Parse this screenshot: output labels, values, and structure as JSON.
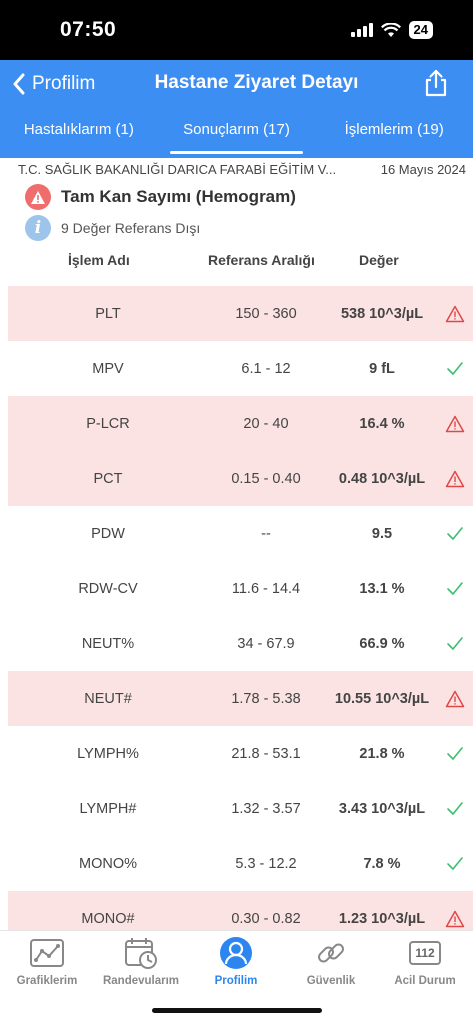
{
  "status": {
    "time": "07:50",
    "battery": "24"
  },
  "nav": {
    "back_label": "Profilim",
    "title": "Hastane Ziyaret Detayı"
  },
  "tabs": [
    {
      "label": "Hastalıklarım (1)"
    },
    {
      "label": "Sonuçlarım (17)"
    },
    {
      "label": "İşlemlerim (19)"
    }
  ],
  "visit": {
    "hospital": "T.C. SAĞLIK BAKANLIĞI DARICA FARABİ EĞİTİM V...",
    "date": "16 Mayıs 2024",
    "test_name": "Tam Kan Sayımı (Hemogram)",
    "out_of_range_text": "9 Değer Referans Dışı"
  },
  "columns": {
    "name": "İşlem Adı",
    "range": "Referans Aralığı",
    "value": "Değer"
  },
  "results": [
    {
      "name": "PLT",
      "range": "150 - 360",
      "value": "538 10^3/µL",
      "out": true
    },
    {
      "name": "MPV",
      "range": "6.1 - 12",
      "value": "9 fL",
      "out": false
    },
    {
      "name": "P-LCR",
      "range": "20 - 40",
      "value": "16.4 %",
      "out": true
    },
    {
      "name": "PCT",
      "range": "0.15 - 0.40",
      "value": "0.48 10^3/µL",
      "out": true
    },
    {
      "name": "PDW",
      "range": "--",
      "value": "9.5",
      "out": false
    },
    {
      "name": "RDW-CV",
      "range": "11.6 - 14.4",
      "value": "13.1 %",
      "out": false
    },
    {
      "name": "NEUT%",
      "range": "34 - 67.9",
      "value": "66.9 %",
      "out": false
    },
    {
      "name": "NEUT#",
      "range": "1.78 - 5.38",
      "value": "10.55 10^3/µL",
      "out": true
    },
    {
      "name": "LYMPH%",
      "range": "21.8 - 53.1",
      "value": "21.8 %",
      "out": false
    },
    {
      "name": "LYMPH#",
      "range": "1.32 - 3.57",
      "value": "3.43 10^3/µL",
      "out": false
    },
    {
      "name": "MONO%",
      "range": "5.3 - 12.2",
      "value": "7.8 %",
      "out": false
    },
    {
      "name": "MONO#",
      "range": "0.30 - 0.82",
      "value": "1.23 10^3/µL",
      "out": true
    }
  ],
  "bottom_tabs": [
    {
      "label": "Grafiklerim",
      "icon": "chart-icon"
    },
    {
      "label": "Randevularım",
      "icon": "calendar-clock-icon"
    },
    {
      "label": "Profilim",
      "icon": "profile-icon"
    },
    {
      "label": "Güvenlik",
      "icon": "link-icon"
    },
    {
      "label": "Acil Durum",
      "icon": "emergency-112-icon",
      "icon_text": "112"
    }
  ],
  "colors": {
    "accent": "#3d8ef2",
    "warning": "#e04848",
    "ok": "#3cbf6e",
    "out_row": "#fbe3e3"
  }
}
